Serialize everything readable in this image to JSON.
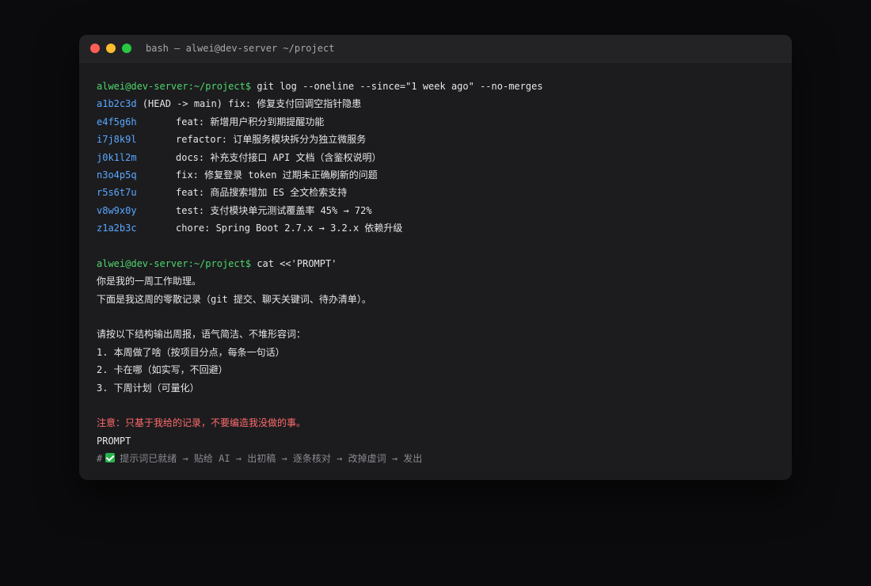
{
  "window": {
    "title": "bash — alwei@dev-server ~/project"
  },
  "terminal": {
    "prompt": "alwei@dev-server:~/project$",
    "command1": "git log --oneline --since=\"1 week ago\" --no-merges",
    "head_commit": {
      "hash": "a1b2c3d",
      "ref": " (HEAD -> main) ",
      "message": "fix: 修复支付回调空指针隐患"
    },
    "commits": [
      {
        "hash": "e4f5g6h",
        "message": "feat: 新增用户积分到期提醒功能"
      },
      {
        "hash": "i7j8k9l",
        "message": "refactor: 订单服务模块拆分为独立微服务"
      },
      {
        "hash": "j0k1l2m",
        "message": "docs: 补充支付接口 API 文档（含鉴权说明）"
      },
      {
        "hash": "n3o4p5q",
        "message": "fix: 修复登录 token 过期未正确刷新的问题"
      },
      {
        "hash": "r5s6t7u",
        "message": "feat: 商品搜索增加 ES 全文检索支持"
      },
      {
        "hash": "v8w9x0y",
        "message": "test: 支付模块单元测试覆盖率 45% → 72%"
      },
      {
        "hash": "z1a2b3c",
        "message": "chore: Spring Boot 2.7.x → 3.2.x 依赖升级"
      }
    ],
    "command2": "cat <<'PROMPT'",
    "prompt_lines": [
      "你是我的一周工作助理。",
      "下面是我这周的零散记录（git 提交、聊天关键词、待办清单）。",
      "",
      "请按以下结构输出周报，语气简洁、不堆形容词：",
      "1. 本周做了啥（按项目分点，每条一句话）",
      "2. 卡在哪（如实写，不回避）",
      "3. 下周计划（可量化）"
    ],
    "warning": "注意：只基于我给的记录，不要编造我没做的事。",
    "heredoc_end": "PROMPT",
    "comment_prefix": "#",
    "comment_text": "提示词已就绪 → 贴给 AI → 出初稿 → 逐条核对 → 改掉虚词 → 发出",
    "check_icon": "check-icon"
  }
}
